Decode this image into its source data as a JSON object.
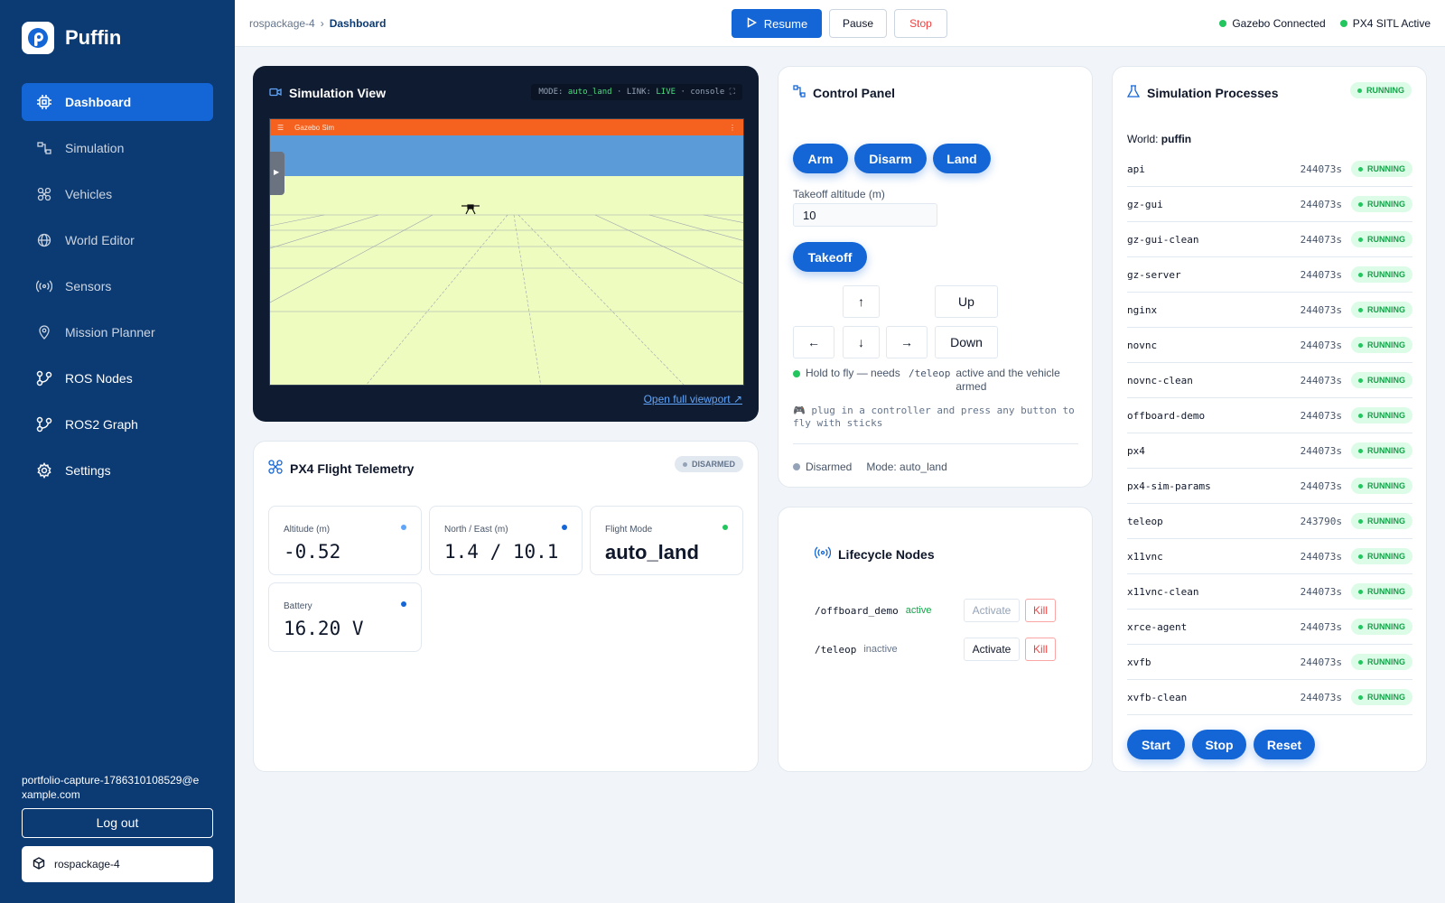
{
  "sidebar": {
    "brand": "Puffin",
    "nav": [
      {
        "label": "Dashboard",
        "icon": "dashboard-icon"
      },
      {
        "label": "Simulation",
        "icon": "simulation-icon"
      },
      {
        "label": "Vehicles",
        "icon": "vehicles-icon"
      },
      {
        "label": "World Editor",
        "icon": "globe-icon"
      },
      {
        "label": "Sensors",
        "icon": "sensors-icon"
      },
      {
        "label": "Mission Planner",
        "icon": "map-pin-icon"
      },
      {
        "label": "ROS Nodes",
        "icon": "graph-icon"
      },
      {
        "label": "ROS2 Graph",
        "icon": "graph-icon"
      },
      {
        "label": "Settings",
        "icon": "gear-icon"
      }
    ],
    "user_email": "portfolio-capture-1786310108529@example.com",
    "logout_label": "Log out",
    "project_name": "rospackage-4"
  },
  "topbar": {
    "breadcrumb_parent": "rospackage-4",
    "breadcrumb_separator": "›",
    "breadcrumb_current": "Dashboard",
    "resume_label": "Resume",
    "pause_label": "Pause",
    "stop_label": "Stop",
    "status_gazebo": "Gazebo Connected",
    "status_px4": "PX4 SITL Active"
  },
  "simview": {
    "title": "Simulation View",
    "mode_prefix": "MODE:",
    "mode_value": "auto_land",
    "link_prefix": "· LINK:",
    "link_value": "LIVE",
    "console_label": "· console ⛶",
    "viewport_title": "Gazebo Sim",
    "open_full_label": "Open full viewport ↗"
  },
  "telemetry": {
    "title": "PX4 Flight Telemetry",
    "badge": "DISARMED",
    "tiles": [
      {
        "label": "Altitude (m)",
        "value": "-0.52",
        "dot_color": "#60a5fa"
      },
      {
        "label": "North / East (m)",
        "value": "1.4 / 10.1",
        "dot_color": "#1466d6"
      },
      {
        "label": "Flight Mode",
        "value": "auto_land",
        "dot_color": "#22c55e"
      },
      {
        "label": "Battery",
        "value": "16.20 V",
        "dot_color": "#1466d6"
      }
    ]
  },
  "control": {
    "title": "Control Panel",
    "arm_label": "Arm",
    "disarm_label": "Disarm",
    "land_label": "Land",
    "altitude_label": "Takeoff altitude (m)",
    "altitude_value": "10",
    "takeoff_label": "Takeoff",
    "up_arrow": "↑",
    "down_arrow": "↓",
    "left_arrow": "←",
    "right_arrow": "→",
    "up_label": "Up",
    "down_label": "Down",
    "hint_part1": "Hold to fly — needs",
    "hint_code": "/teleop",
    "hint_part2": "active and the vehicle armed",
    "gamepad_hint": "plug in a controller and press any button to fly with sticks",
    "status_state": "Disarmed",
    "status_mode": "Mode: auto_land"
  },
  "lifecycle": {
    "title": "Lifecycle Nodes",
    "nodes": [
      {
        "name": "/offboard_demo",
        "state": "active",
        "activate": "Activate",
        "kill": "Kill"
      },
      {
        "name": "/teleop",
        "state": "inactive",
        "activate": "Activate",
        "kill": "Kill"
      }
    ]
  },
  "processes": {
    "title": "Simulation Processes",
    "status_badge": "RUNNING",
    "world_label": "World:",
    "world_name": "puffin",
    "items": [
      {
        "name": "api",
        "uptime": "244073s",
        "status": "RUNNING"
      },
      {
        "name": "gz-gui",
        "uptime": "244073s",
        "status": "RUNNING"
      },
      {
        "name": "gz-gui-clean",
        "uptime": "244073s",
        "status": "RUNNING"
      },
      {
        "name": "gz-server",
        "uptime": "244073s",
        "status": "RUNNING"
      },
      {
        "name": "nginx",
        "uptime": "244073s",
        "status": "RUNNING"
      },
      {
        "name": "novnc",
        "uptime": "244073s",
        "status": "RUNNING"
      },
      {
        "name": "novnc-clean",
        "uptime": "244073s",
        "status": "RUNNING"
      },
      {
        "name": "offboard-demo",
        "uptime": "244073s",
        "status": "RUNNING"
      },
      {
        "name": "px4",
        "uptime": "244073s",
        "status": "RUNNING"
      },
      {
        "name": "px4-sim-params",
        "uptime": "244073s",
        "status": "RUNNING"
      },
      {
        "name": "teleop",
        "uptime": "243790s",
        "status": "RUNNING"
      },
      {
        "name": "x11vnc",
        "uptime": "244073s",
        "status": "RUNNING"
      },
      {
        "name": "x11vnc-clean",
        "uptime": "244073s",
        "status": "RUNNING"
      },
      {
        "name": "xrce-agent",
        "uptime": "244073s",
        "status": "RUNNING"
      },
      {
        "name": "xvfb",
        "uptime": "244073s",
        "status": "RUNNING"
      },
      {
        "name": "xvfb-clean",
        "uptime": "244073s",
        "status": "RUNNING"
      }
    ],
    "start_label": "Start",
    "stop_label": "Stop",
    "reset_label": "Reset"
  },
  "colors": {
    "sidebar_bg": "#0c3a73",
    "accent": "#1466d6",
    "running_green": "#16a34a",
    "danger": "#ef4444"
  }
}
